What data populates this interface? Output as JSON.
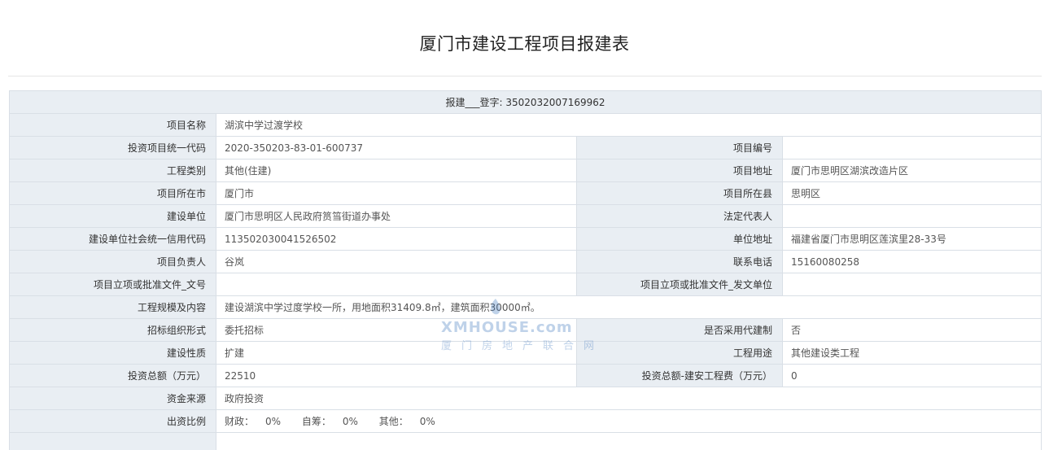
{
  "title": "厦门市建设工程项目报建表",
  "register_no": "报建___登字: 3502032007169962",
  "fields": {
    "project_name": {
      "label": "项目名称",
      "value": "湖滨中学过渡学校"
    },
    "invest_code": {
      "label": "投资项目统一代码",
      "value": "2020-350203-83-01-600737"
    },
    "project_no": {
      "label": "项目编号",
      "value": ""
    },
    "project_type": {
      "label": "工程类别",
      "value": "其他(住建)"
    },
    "project_address": {
      "label": "项目地址",
      "value": "厦门市思明区湖滨改造片区"
    },
    "city": {
      "label": "项目所在市",
      "value": "厦门市"
    },
    "county": {
      "label": "项目所在县",
      "value": "思明区"
    },
    "builder": {
      "label": "建设单位",
      "value": "厦门市思明区人民政府筼筜街道办事处"
    },
    "legal_rep": {
      "label": "法定代表人",
      "value": ""
    },
    "credit_code": {
      "label": "建设单位社会统一信用代码",
      "value": "11350203004152650​2"
    },
    "unit_address": {
      "label": "单位地址",
      "value": "福建省厦门市思明区莲滨里28-33号"
    },
    "manager": {
      "label": "项目负责人",
      "value": "谷岚"
    },
    "phone": {
      "label": "联系电话",
      "value": "15160080258"
    },
    "approval_doc_no": {
      "label": "项目立项或批准文件_文号",
      "value": ""
    },
    "approval_doc_unit": {
      "label": "项目立项或批准文件_发文单位",
      "value": ""
    },
    "scale": {
      "label": "工程规模及内容",
      "value": "建设湖滨中学过度学校一所，用地面积31409.8㎡，建筑面积30000㎡。"
    },
    "bidding_form": {
      "label": "招标组织形式",
      "value": "委托招标"
    },
    "agent_system": {
      "label": "是否采用代建制",
      "value": "否"
    },
    "nature": {
      "label": "建设性质",
      "value": "扩建"
    },
    "usage": {
      "label": "工程用途",
      "value": "其他建设类工程"
    },
    "total_invest": {
      "label": "投资总额（万元）",
      "value": "22510"
    },
    "construction_cost": {
      "label": "投资总额-建安工程费（万元）",
      "value": "0"
    },
    "fund_source": {
      "label": "资金来源",
      "value": "政府投资"
    },
    "fund_ratio": {
      "label": "出资比例",
      "parts": [
        {
          "key": "财政：",
          "value": "0%"
        },
        {
          "key": "自筹：",
          "value": "0%"
        },
        {
          "key": "其他：",
          "value": "0%"
        }
      ]
    }
  },
  "watermark": {
    "top": "XMHOUSE.com",
    "bottom": "厦门房地产联合网"
  },
  "colors": {
    "label_bg": "#e9eef3",
    "border": "#d9dfe6",
    "watermark": "#4a7fc1"
  }
}
